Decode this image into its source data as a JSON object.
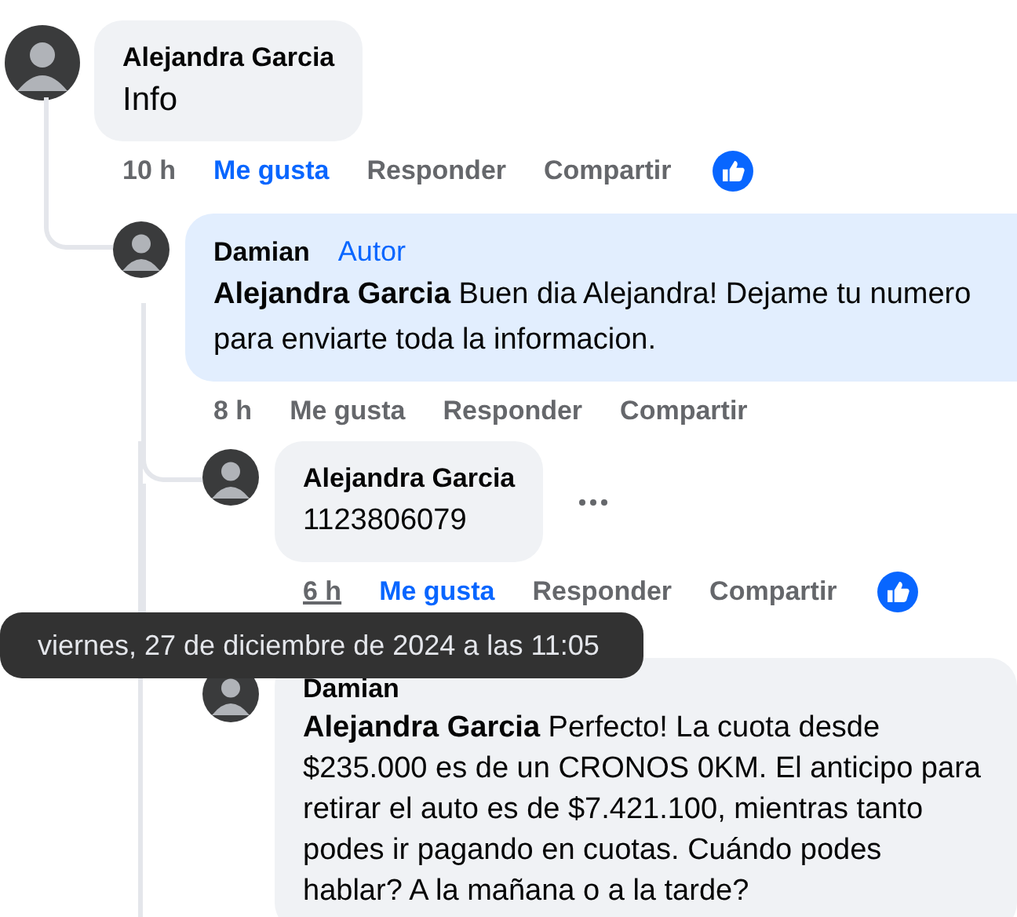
{
  "comments": [
    {
      "author": "Alejandra Garcia",
      "text": "Info",
      "time": "10 h",
      "time_hovered": false,
      "like": "Me gusta",
      "liked": true,
      "reply": "Responder",
      "share": "Compartir",
      "reaction": true,
      "highlighted": false,
      "more_button": false,
      "children": [
        {
          "author": "Damian",
          "badge": "Autor",
          "text": "**Alejandra Garcia** Buen dia Alejandra! Dejame tu numero para enviarte toda la informacion.",
          "time": "8 h",
          "time_hovered": false,
          "like": "Me gusta",
          "liked": false,
          "reply": "Responder",
          "share": "Compartir",
          "reaction": false,
          "highlighted": true,
          "more_button": false,
          "children": [
            {
              "author": "Alejandra Garcia",
              "text": "1123806079",
              "time": "6 h",
              "time_hovered": true,
              "like": "Me gusta",
              "liked": true,
              "reply": "Responder",
              "share": "Compartir",
              "reaction": true,
              "highlighted": false,
              "more_button": true
            },
            {
              "author": "Damian",
              "text": "**Alejandra Garcia** Perfecto! La cuota desde $235.000 es de un CRONOS 0KM. El anticipo para retirar el auto es de $7.421.100, mientras tanto podes ir pagando en cuotas. Cuándo podes hablar? A la mañana o a la tarde?",
              "highlighted": false,
              "more_button": false
            }
          ]
        }
      ]
    }
  ],
  "tooltip": {
    "text": "viernes, 27 de diciembre de 2024 a las 11:05"
  }
}
